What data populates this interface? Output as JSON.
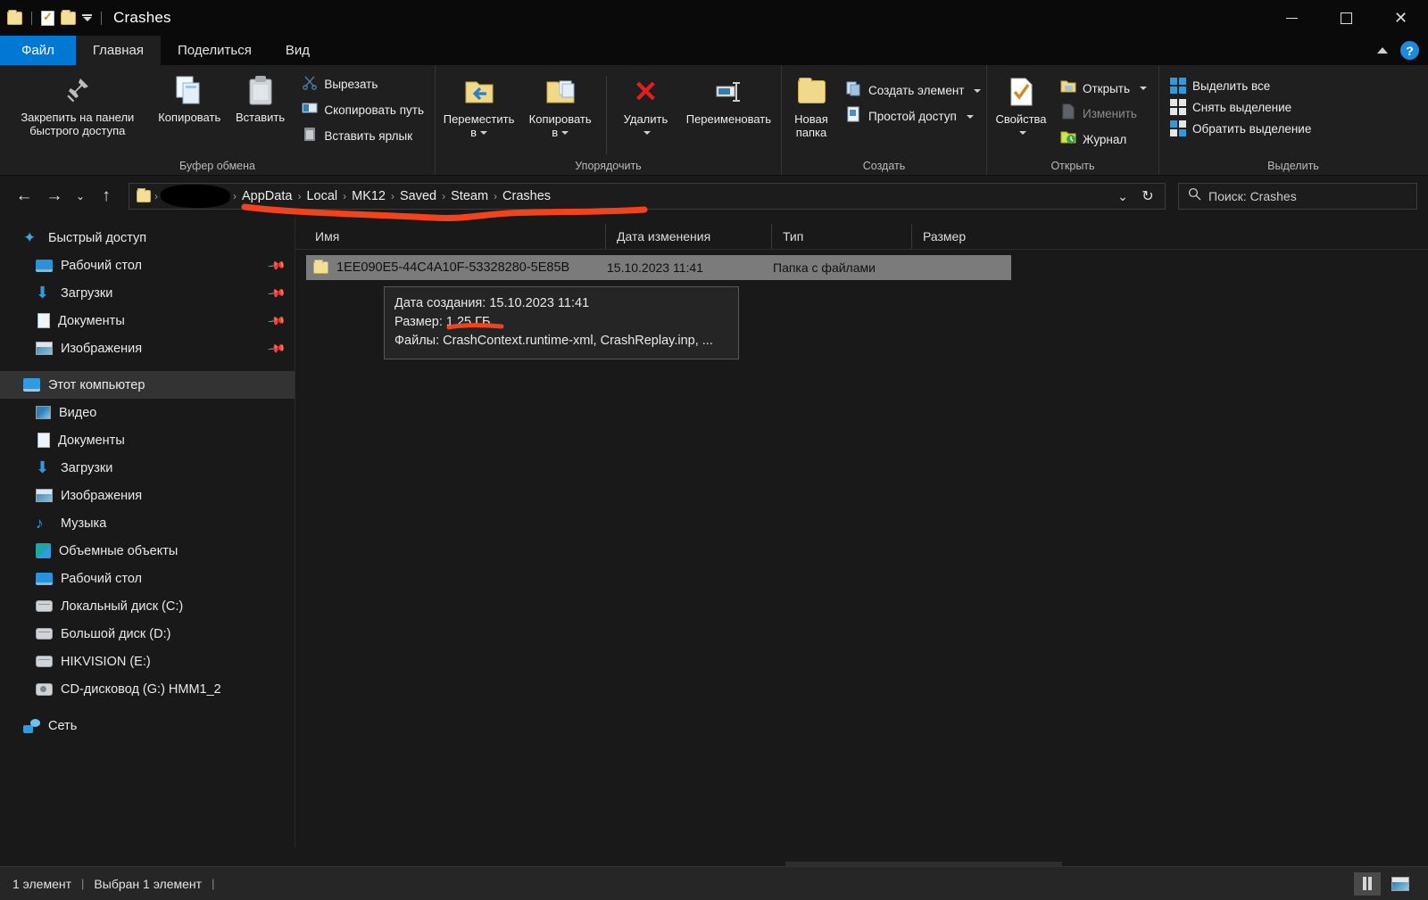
{
  "window": {
    "title": "Crashes",
    "quick_access": [
      "folder-icon",
      "properties-icon",
      "new-folder-icon",
      "customize-caret-icon"
    ],
    "controls": {
      "minimize": "minimize-icon",
      "maximize": "maximize-icon",
      "close": "close-icon"
    }
  },
  "ribbon_tabs": [
    {
      "label": "Файл",
      "state": "file"
    },
    {
      "label": "Главная",
      "state": "active"
    },
    {
      "label": "Поделиться",
      "state": "normal"
    },
    {
      "label": "Вид",
      "state": "normal"
    }
  ],
  "ribbon_right": {
    "collapse": "chevron-up-icon",
    "help": "?"
  },
  "ribbon": {
    "groups": [
      {
        "title": "Буфер обмена",
        "big_buttons": [
          {
            "label": "Закрепить на панели быстрого доступа",
            "icon": "pin-icon"
          },
          {
            "label": "Копировать",
            "icon": "copy-icon"
          },
          {
            "label": "Вставить",
            "icon": "paste-icon"
          }
        ],
        "small_buttons": [
          {
            "label": "Вырезать",
            "icon": "scissors-icon"
          },
          {
            "label": "Скопировать путь",
            "icon": "copy-path-icon"
          },
          {
            "label": "Вставить ярлык",
            "icon": "paste-shortcut-icon"
          }
        ]
      },
      {
        "title": "Упорядочить",
        "big_buttons": [
          {
            "label": "Переместить в",
            "icon": "move-to-icon",
            "caret": true
          },
          {
            "label": "Копировать в",
            "icon": "copy-to-icon",
            "caret": true
          },
          {
            "label": "Удалить",
            "icon": "delete-icon",
            "caret": true
          },
          {
            "label": "Переименовать",
            "icon": "rename-icon"
          }
        ],
        "small_buttons": []
      },
      {
        "title": "Создать",
        "big_buttons": [
          {
            "label": "Новая папка",
            "icon": "new-folder-icon"
          }
        ],
        "small_buttons": [
          {
            "label": "Создать элемент",
            "icon": "new-item-icon",
            "caret": true
          },
          {
            "label": "Простой доступ",
            "icon": "easy-access-icon",
            "caret": true
          }
        ]
      },
      {
        "title": "Открыть",
        "big_buttons": [
          {
            "label": "Свойства",
            "icon": "properties-icon",
            "caret": true
          }
        ],
        "small_buttons": [
          {
            "label": "Открыть",
            "icon": "open-icon",
            "caret": true
          },
          {
            "label": "Изменить",
            "icon": "edit-icon",
            "disabled": true
          },
          {
            "label": "Журнал",
            "icon": "history-icon"
          }
        ]
      },
      {
        "title": "Выделить",
        "big_buttons": [],
        "small_buttons": [
          {
            "label": "Выделить все",
            "icon": "select-all-icon"
          },
          {
            "label": "Снять выделение",
            "icon": "select-none-icon"
          },
          {
            "label": "Обратить выделение",
            "icon": "invert-selection-icon"
          }
        ]
      }
    ]
  },
  "addressbar": {
    "back": "back-arrow-icon",
    "forward": "forward-arrow-icon",
    "recent": "chevron-down-icon",
    "up": "up-arrow-icon",
    "breadcrumbs": [
      "",
      "AppData",
      "Local",
      "MK12",
      "Saved",
      "Steam",
      "Crashes"
    ],
    "dropdown": "chevron-down-icon",
    "refresh": "refresh-icon"
  },
  "search": {
    "placeholder": "Поиск: Crashes",
    "icon": "search-icon"
  },
  "sidebar": {
    "items": [
      {
        "label": "Быстрый доступ",
        "icon": "star-icon",
        "level": 1,
        "pinned": false,
        "selected": false
      },
      {
        "label": "Рабочий стол",
        "icon": "desktop-icon",
        "level": 2,
        "pinned": true,
        "selected": false
      },
      {
        "label": "Загрузки",
        "icon": "downloads-icon",
        "level": 2,
        "pinned": true,
        "selected": false
      },
      {
        "label": "Документы",
        "icon": "documents-icon",
        "level": 2,
        "pinned": true,
        "selected": false
      },
      {
        "label": "Изображения",
        "icon": "pictures-icon",
        "level": 2,
        "pinned": true,
        "selected": false
      },
      {
        "label": "Этот компьютер",
        "icon": "this-pc-icon",
        "level": 1,
        "pinned": false,
        "selected": true
      },
      {
        "label": "Видео",
        "icon": "videos-icon",
        "level": 2,
        "pinned": false,
        "selected": false
      },
      {
        "label": "Документы",
        "icon": "documents-icon",
        "level": 2,
        "pinned": false,
        "selected": false
      },
      {
        "label": "Загрузки",
        "icon": "downloads-icon",
        "level": 2,
        "pinned": false,
        "selected": false
      },
      {
        "label": "Изображения",
        "icon": "pictures-icon",
        "level": 2,
        "pinned": false,
        "selected": false
      },
      {
        "label": "Музыка",
        "icon": "music-icon",
        "level": 2,
        "pinned": false,
        "selected": false
      },
      {
        "label": "Объемные объекты",
        "icon": "3d-objects-icon",
        "level": 2,
        "pinned": false,
        "selected": false
      },
      {
        "label": "Рабочий стол",
        "icon": "desktop-icon",
        "level": 2,
        "pinned": false,
        "selected": false
      },
      {
        "label": "Локальный диск (C:)",
        "icon": "drive-icon",
        "level": 2,
        "pinned": false,
        "selected": false
      },
      {
        "label": "Большой диск (D:)",
        "icon": "drive-icon",
        "level": 2,
        "pinned": false,
        "selected": false
      },
      {
        "label": "HIKVISION (E:)",
        "icon": "drive-icon",
        "level": 2,
        "pinned": false,
        "selected": false
      },
      {
        "label": "CD-дисковод (G:) HMM1_2",
        "icon": "cd-drive-icon",
        "level": 2,
        "pinned": false,
        "selected": false
      },
      {
        "label": "Сеть",
        "icon": "network-icon",
        "level": 1,
        "pinned": false,
        "selected": false
      }
    ]
  },
  "filelist": {
    "columns": [
      "Имя",
      "Дата изменения",
      "Тип",
      "Размер"
    ],
    "rows": [
      {
        "name": "1EE090E5-44C4A10F-53328280-5E85B",
        "date": "15.10.2023 11:41",
        "type": "Папка с файлами",
        "size": "",
        "selected": true,
        "icon": "folder-icon"
      }
    ]
  },
  "tooltip": {
    "lines": [
      "Дата создания: 15.10.2023 11:41",
      "Размер: 1,25 ГБ",
      "Файлы: CrashContext.runtime-xml, CrashReplay.inp, ..."
    ]
  },
  "statusbar": {
    "count_text": "1 элемент",
    "selected_text": "Выбран 1 элемент",
    "separator": "|",
    "view_details_icon": "details-view-icon",
    "view_icons_icon": "large-icons-view-icon"
  },
  "annotations": {
    "color": "#f4431c",
    "path_underline": "red-underline-breadcrumb",
    "size_underline": "red-underline-size"
  }
}
